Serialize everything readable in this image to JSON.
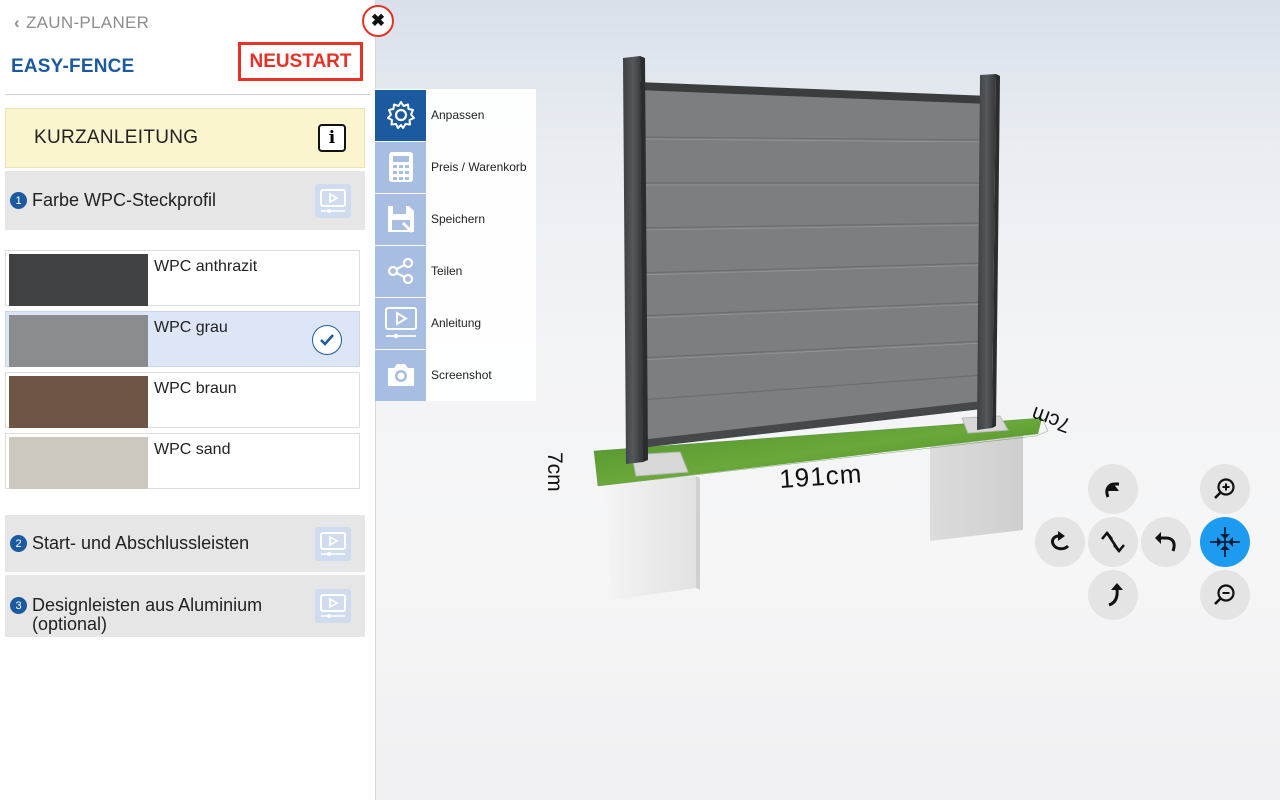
{
  "header": {
    "back_label": "ZAUN-PLANER",
    "brand": "EASY-FENCE",
    "restart_label": "NEUSTART"
  },
  "quick_guide": {
    "label": "KURZANLEITUNG",
    "icon": "info-icon"
  },
  "sections": [
    {
      "number": "1",
      "title": "Farbe WPC-Steckprofil"
    },
    {
      "number": "2",
      "title": "Start- und Abschlussleisten"
    },
    {
      "number": "3",
      "title": "Designleisten aus Aluminium (optional)"
    }
  ],
  "colors": [
    {
      "name": "WPC anthrazit",
      "hex": "#404143",
      "selected": false
    },
    {
      "name": "WPC grau",
      "hex": "#8a8c8f",
      "selected": true
    },
    {
      "name": "WPC braun",
      "hex": "#6f5546",
      "selected": false
    },
    {
      "name": "WPC sand",
      "hex": "#ccc8bf",
      "selected": false
    }
  ],
  "tools": [
    {
      "label": "Anpassen",
      "icon": "gear-icon",
      "active": true
    },
    {
      "label": "Preis / Warenkorb",
      "icon": "calculator-icon",
      "active": false
    },
    {
      "label": "Speichern",
      "icon": "save-icon",
      "active": false
    },
    {
      "label": "Teilen",
      "icon": "share-icon",
      "active": false
    },
    {
      "label": "Anleitung",
      "icon": "video-icon",
      "active": false
    },
    {
      "label": "Screenshot",
      "icon": "camera-icon",
      "active": false
    }
  ],
  "scene": {
    "width_label": "191cm",
    "depth_label_left": "7cm",
    "depth_label_right": "7cm"
  },
  "accent_colors": {
    "brand_blue": "#1c5aa0",
    "restart_red": "#e53126",
    "active_nav": "#1d9bf0"
  }
}
